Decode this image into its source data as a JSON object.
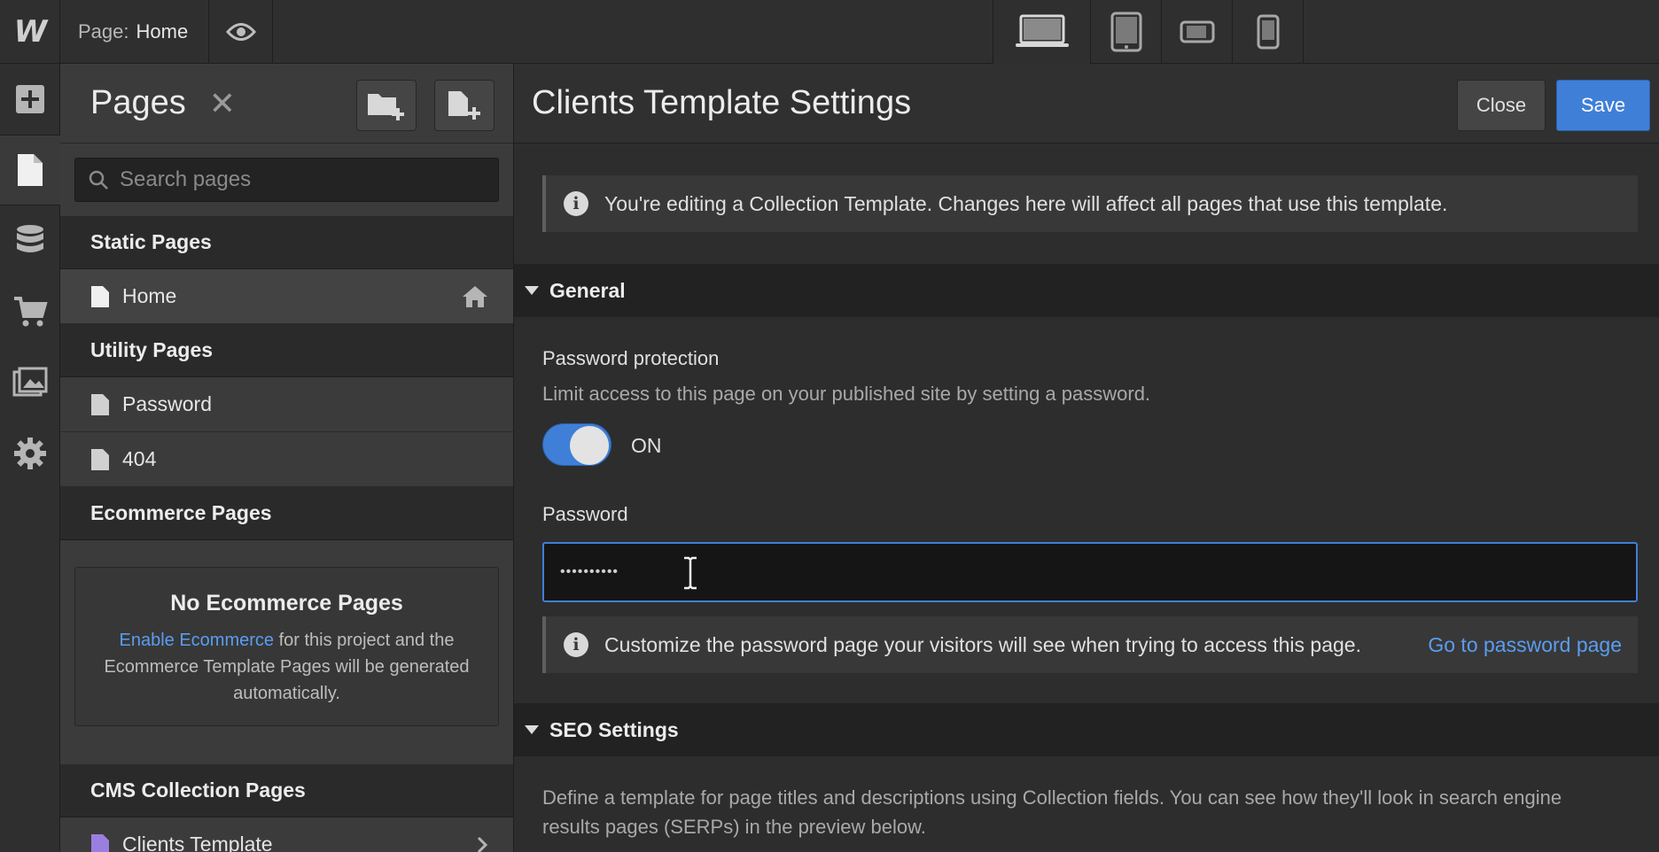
{
  "topbar": {
    "logo": "W",
    "page_key": "Page:",
    "page_value": "Home",
    "icons": [
      "eye-icon",
      "desktop-icon",
      "tablet-icon",
      "mobile-landscape-icon",
      "mobile-portrait-icon"
    ]
  },
  "rail": {
    "items": [
      "add-icon",
      "pages-icon",
      "cms-icon",
      "ecommerce-icon",
      "assets-icon",
      "settings-icon"
    ],
    "active": "pages-icon"
  },
  "pages_panel": {
    "title": "Pages",
    "close_glyph": "✕",
    "search_placeholder": "Search pages",
    "static_heading": "Static Pages",
    "static_items": [
      {
        "label": "Home"
      }
    ],
    "utility_heading": "Utility Pages",
    "utility_items": [
      {
        "label": "Password"
      },
      {
        "label": "404"
      }
    ],
    "ecommerce_heading": "Ecommerce Pages",
    "ecommerce_empty_title": "No Ecommerce Pages",
    "ecommerce_link": "Enable Ecommerce",
    "ecommerce_text_1": " for this project and the Ecommerce Template Pages will be generated automatically.",
    "cms_heading": "CMS Collection Pages",
    "cms_items": [
      {
        "label": "Clients Template"
      }
    ]
  },
  "settings": {
    "title": "Clients Template Settings",
    "close_label": "Close",
    "save_label": "Save",
    "info_text": "You're editing a Collection Template. Changes here will affect all pages that use this template.",
    "general_heading": "General",
    "pw_protection_label": "Password protection",
    "pw_protection_hint": "Limit access to this page on your published site by setting a password.",
    "toggle_state": "ON",
    "password_label": "Password",
    "password_value": "••••••••••",
    "pw_info_text": "Customize the password page your visitors will see when trying to access this page.",
    "pw_info_link": "Go to password page",
    "seo_heading": "SEO Settings",
    "seo_description": "Define a template for page titles and descriptions using Collection fields. You can see how they'll look in search engine results pages (SERPs) in the preview below."
  },
  "colors": {
    "accent": "#3f7fd8",
    "link": "#5a9df1",
    "cms_page_icon": "#9b7fe0"
  }
}
